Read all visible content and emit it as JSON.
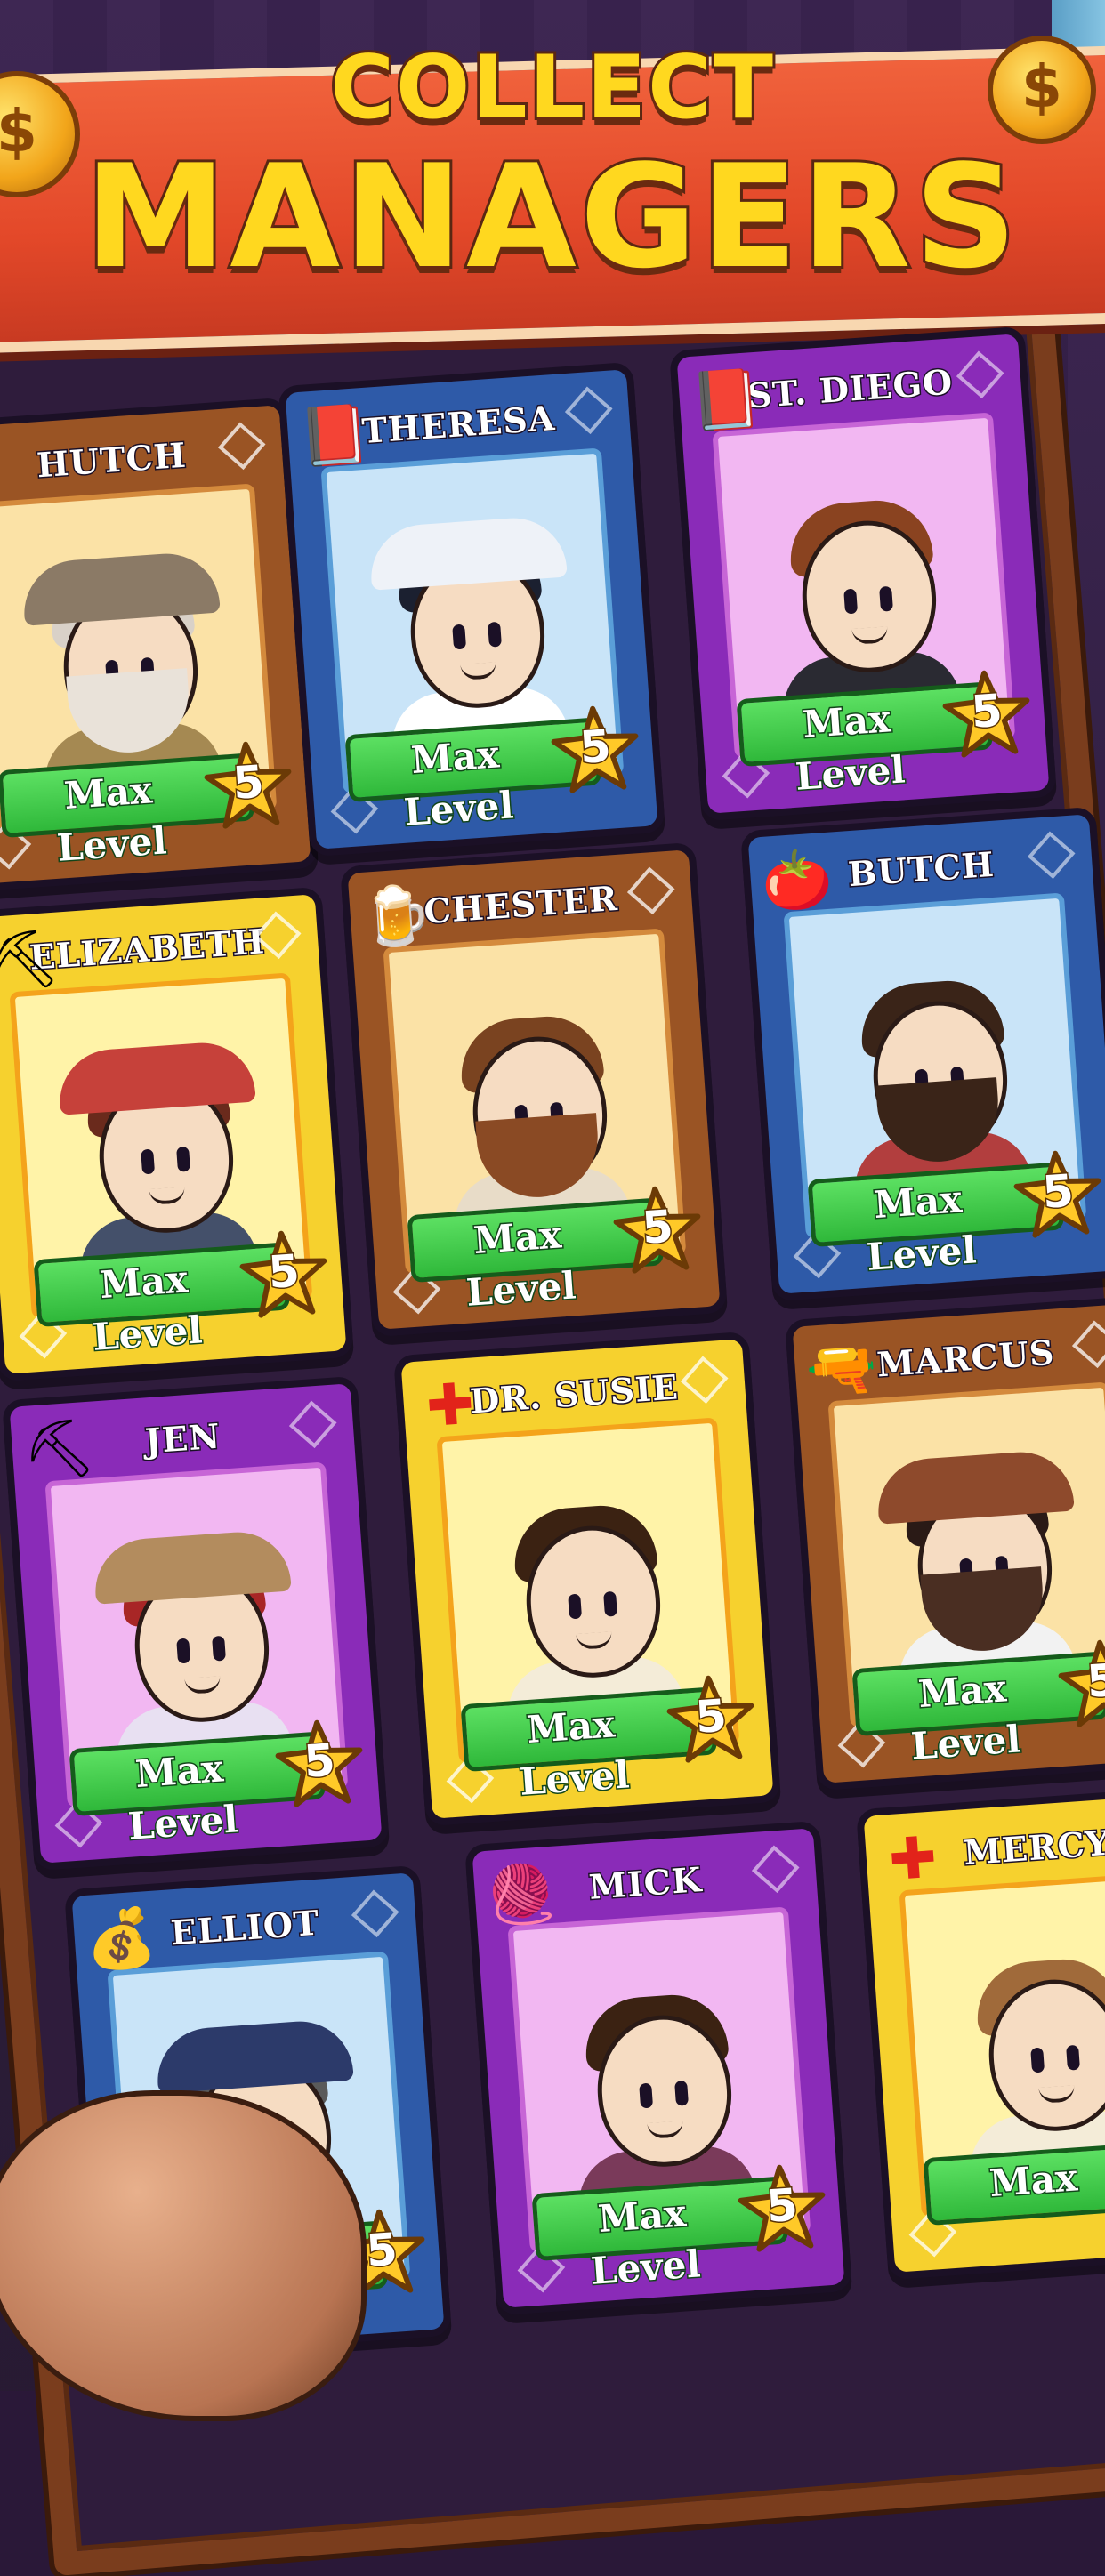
{
  "banner": {
    "line1": "COLLECT",
    "line2": "MANAGERS",
    "coin_symbol": "$"
  },
  "level_label": "Max Level",
  "cards": [
    {
      "name": "HUTCH",
      "theme": "brown",
      "stars": "5",
      "badge": "",
      "hair": "#d9d1c8",
      "hat": "#8b7a66",
      "outfit": "#a58952",
      "beard": "#e9e2d9"
    },
    {
      "name": "THERESA",
      "theme": "blue",
      "stars": "5",
      "badge": "book-icon",
      "hair": "#1b2030",
      "hat": "#eef2f8",
      "outfit": "#ffffff",
      "beard": ""
    },
    {
      "name": "ST. DIEGO",
      "theme": "purple",
      "stars": "5",
      "badge": "book-icon",
      "hair": "#8a4320",
      "hat": "",
      "outfit": "#2a2a32",
      "beard": ""
    },
    {
      "name": "ELIZABETH",
      "theme": "yellow",
      "stars": "5",
      "badge": "pickaxe-icon",
      "hair": "#6a2a1c",
      "hat": "#c6413a",
      "outfit": "#44506a",
      "beard": ""
    },
    {
      "name": "CHESTER",
      "theme": "brown",
      "stars": "5",
      "badge": "beer-mug-icon",
      "hair": "#7a4320",
      "hat": "",
      "outfit": "#e8dcc8",
      "beard": "#8a4a24"
    },
    {
      "name": "BUTCH",
      "theme": "blue",
      "stars": "5",
      "badge": "vegetables-icon",
      "hair": "#3a2418",
      "hat": "",
      "outfit": "#b23e3e",
      "beard": "#3a2418"
    },
    {
      "name": "JEN",
      "theme": "purple",
      "stars": "5",
      "badge": "pickaxe-icon",
      "hair": "#a82626",
      "hat": "#b38c5e",
      "outfit": "#e8e0f2",
      "beard": ""
    },
    {
      "name": "DR. SUSIE",
      "theme": "yellow",
      "stars": "5",
      "badge": "medical-cross-icon",
      "hair": "#3b2212",
      "hat": "",
      "outfit": "#f4ecd8",
      "beard": ""
    },
    {
      "name": "MARCUS",
      "theme": "brown",
      "stars": "5",
      "badge": "revolver-icon",
      "hair": "#2a1a16",
      "hat": "#8e4a2c",
      "outfit": "#f2f2f2",
      "beard": "#4a2e22"
    },
    {
      "name": "ELLIOT",
      "theme": "blue",
      "stars": "5",
      "badge": "money-bag-icon",
      "hair": "#5a5a5a",
      "hat": "#2c3a6a",
      "outfit": "#2c3a6a",
      "beard": ""
    },
    {
      "name": "MICK",
      "theme": "purple",
      "stars": "5",
      "badge": "yarn-icon",
      "hair": "#3b2212",
      "hat": "",
      "outfit": "#7a3a5a",
      "beard": ""
    },
    {
      "name": "MERCY",
      "theme": "yellow",
      "stars": "",
      "badge": "medical-cross-icon",
      "hair": "#a06a3a",
      "hat": "",
      "outfit": "#f4ecd8",
      "beard": ""
    }
  ],
  "short_level_label": "Max"
}
